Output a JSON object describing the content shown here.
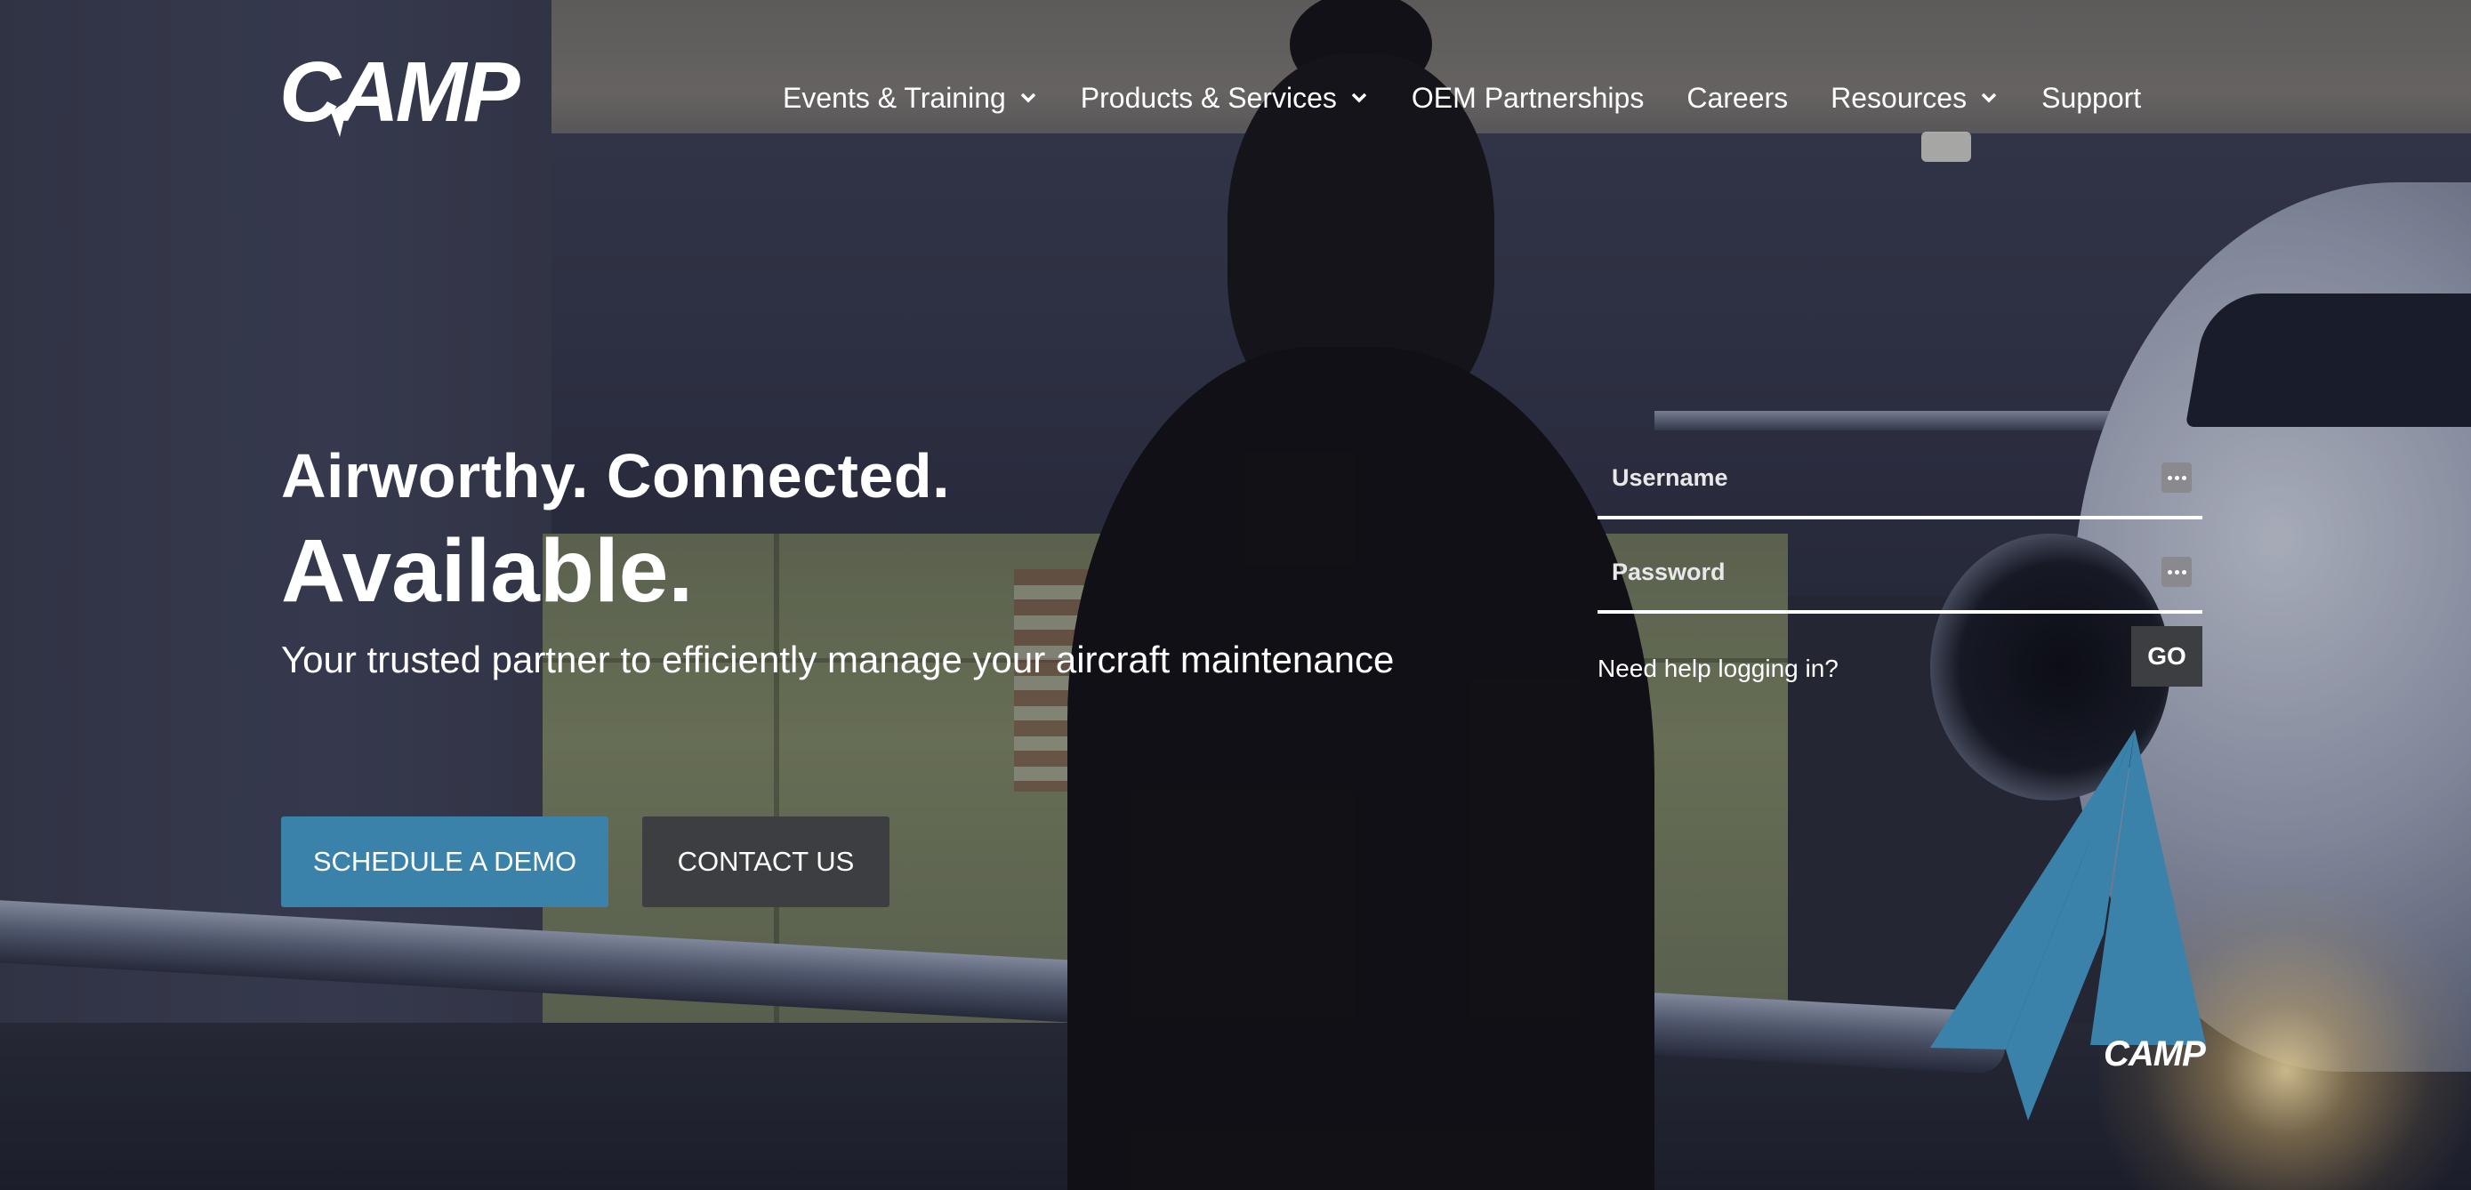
{
  "brand": {
    "name": "CAMP",
    "accent": "#3a82aa"
  },
  "nav": {
    "items": [
      {
        "label": "Events & Training",
        "dropdown": true
      },
      {
        "label": "Products & Services",
        "dropdown": true
      },
      {
        "label": "OEM Partnerships",
        "dropdown": false
      },
      {
        "label": "Careers",
        "dropdown": false
      },
      {
        "label": "Resources",
        "dropdown": true
      },
      {
        "label": "Support",
        "dropdown": false
      }
    ]
  },
  "hero": {
    "line1": "Airworthy. Connected.",
    "line2": "Available.",
    "subtitle": "Your trusted partner to efficiently manage your aircraft maintenance",
    "primary_cta": "SCHEDULE A DEMO",
    "secondary_cta": "CONTACT US"
  },
  "login": {
    "username_placeholder": "Username",
    "password_placeholder": "Password",
    "help_link": "Need help logging in?",
    "submit": "GO"
  },
  "badge": {
    "text": "CAMP"
  }
}
